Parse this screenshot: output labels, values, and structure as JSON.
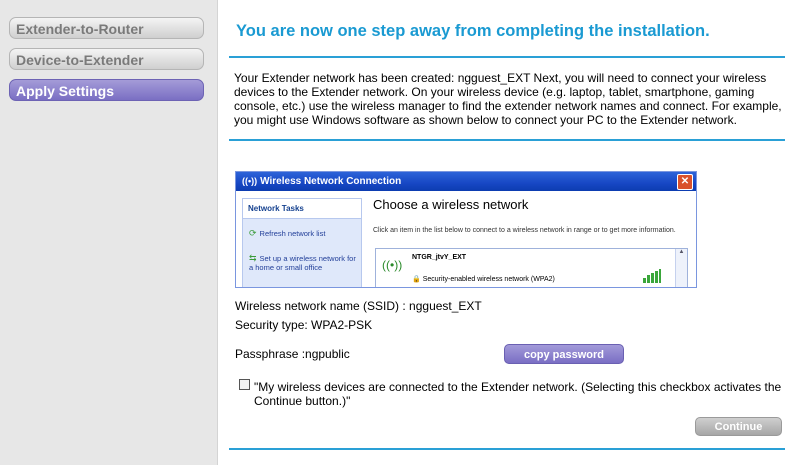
{
  "sidebar": {
    "items": [
      {
        "label": "Extender-to-Router"
      },
      {
        "label": "Device-to-Extender"
      },
      {
        "label": "Apply Settings"
      }
    ]
  },
  "main": {
    "heading": "You are now one step away from completing the installation.",
    "intro": "Your Extender network has been created: ngguest_EXT Next, you will need to connect your wireless devices to the Extender network. On your wireless device (e.g. laptop, tablet, smartphone, gaming console, etc.) use the wireless manager to find the extender network names and connect. For example, you might use Windows software as shown below to connect your PC to the Extender network.",
    "screenshot": {
      "window_title": "Wireless Network Connection",
      "tasks_header": "Network Tasks",
      "task1": "Refresh network list",
      "task2": "Set up a wireless network for a home or small office",
      "panel_title": "Choose a wireless network",
      "panel_hint": "Click an item in the list below to connect to a wireless network in range or to get more information.",
      "network_name": "NTGR_jtvY_EXT",
      "network_security": "Security-enabled wireless network (WPA2)"
    },
    "ssid_line": "Wireless network name (SSID) : ngguest_EXT",
    "security_line": "Security type: WPA2-PSK",
    "passphrase_line": "Passphrase :ngpublic",
    "copy_button": "copy password",
    "checkbox_text": "\"My wireless devices are connected to the Extender network. (Selecting this checkbox activates the Continue button.)\"",
    "continue_button": "Continue"
  },
  "colors": {
    "accent": "#1a9ad2",
    "button_purple": "#7a6fc3",
    "button_disabled": "#a6a6a6"
  }
}
